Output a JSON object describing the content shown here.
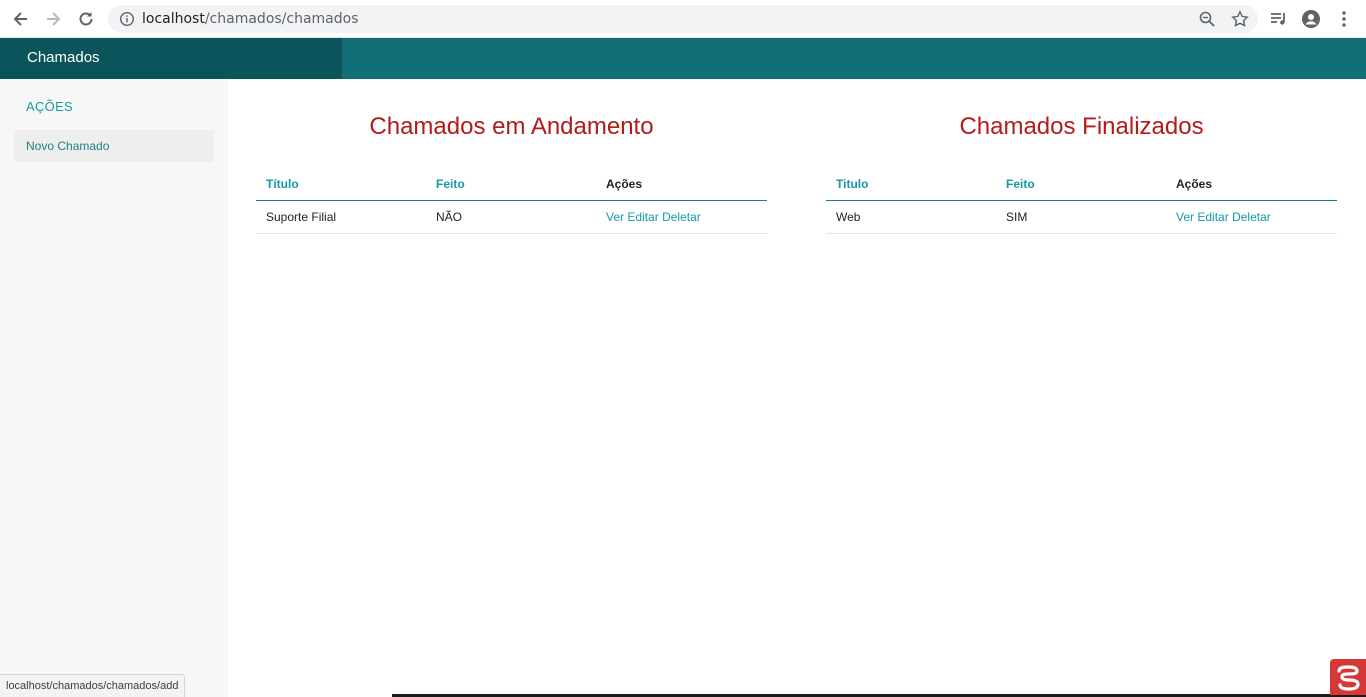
{
  "browser": {
    "url_host": "localhost",
    "url_path": "/chamados/chamados",
    "status_url": "localhost/chamados/chamados/add"
  },
  "header": {
    "title": "Chamados"
  },
  "sidebar": {
    "heading": "AÇÕES",
    "items": [
      {
        "label": "Novo Chamado"
      }
    ]
  },
  "panels": {
    "in_progress": {
      "title": "Chamados em Andamento",
      "columns": [
        "Título",
        "Feito",
        "Ações"
      ],
      "rows": [
        {
          "titulo": "Suporte Filial",
          "feito": "NÃO",
          "actions": [
            "Ver",
            "Editar",
            "Deletar"
          ]
        }
      ]
    },
    "finished": {
      "title": "Chamados Finalizados",
      "columns": [
        "Titulo",
        "Feito",
        "Ações"
      ],
      "rows": [
        {
          "titulo": "Web",
          "feito": "SIM",
          "actions": [
            "Ver",
            "Editar",
            "Deletar"
          ]
        }
      ]
    }
  },
  "icons": {
    "back": "arrow-left-icon",
    "forward": "arrow-right-icon",
    "reload": "reload-icon",
    "info": "info-icon",
    "zoom": "zoom-icon",
    "star": "star-icon",
    "media": "media-queue-icon",
    "profile": "account-icon",
    "menu": "kebab-menu-icon"
  },
  "colors": {
    "header_bar": "#116e76",
    "brand_block": "#0b545b",
    "accent": "#1798a5",
    "title_red": "#b31b1b"
  }
}
